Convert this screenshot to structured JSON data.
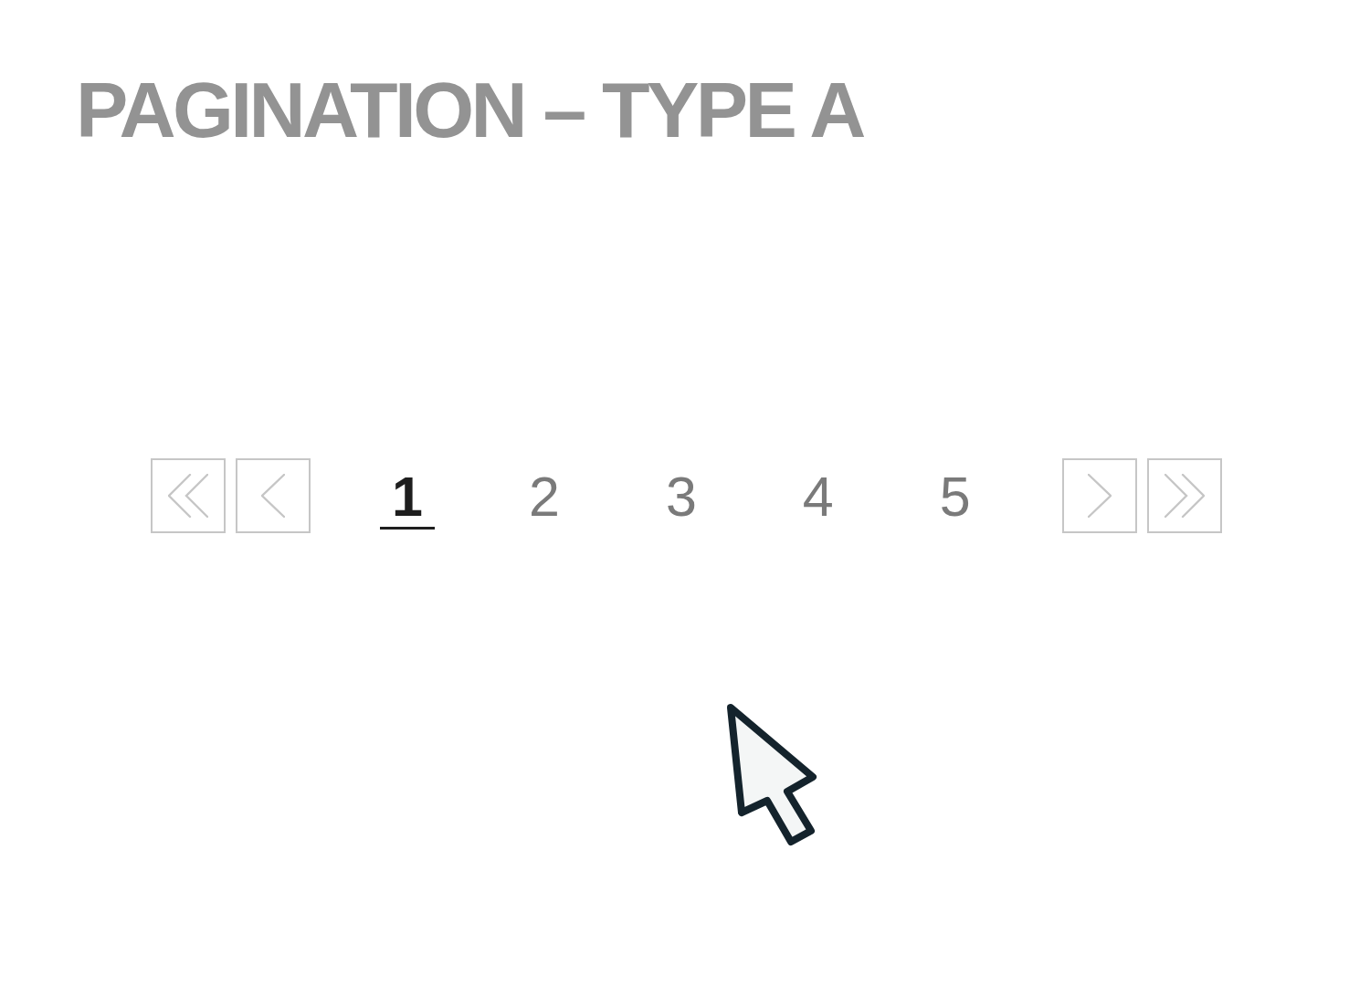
{
  "title": "PAGINATION – TYPE A",
  "pages": [
    {
      "label": "1",
      "selected": true
    },
    {
      "label": "2",
      "selected": false
    },
    {
      "label": "3",
      "selected": false
    },
    {
      "label": "4",
      "selected": false
    },
    {
      "label": "5",
      "selected": false
    }
  ]
}
